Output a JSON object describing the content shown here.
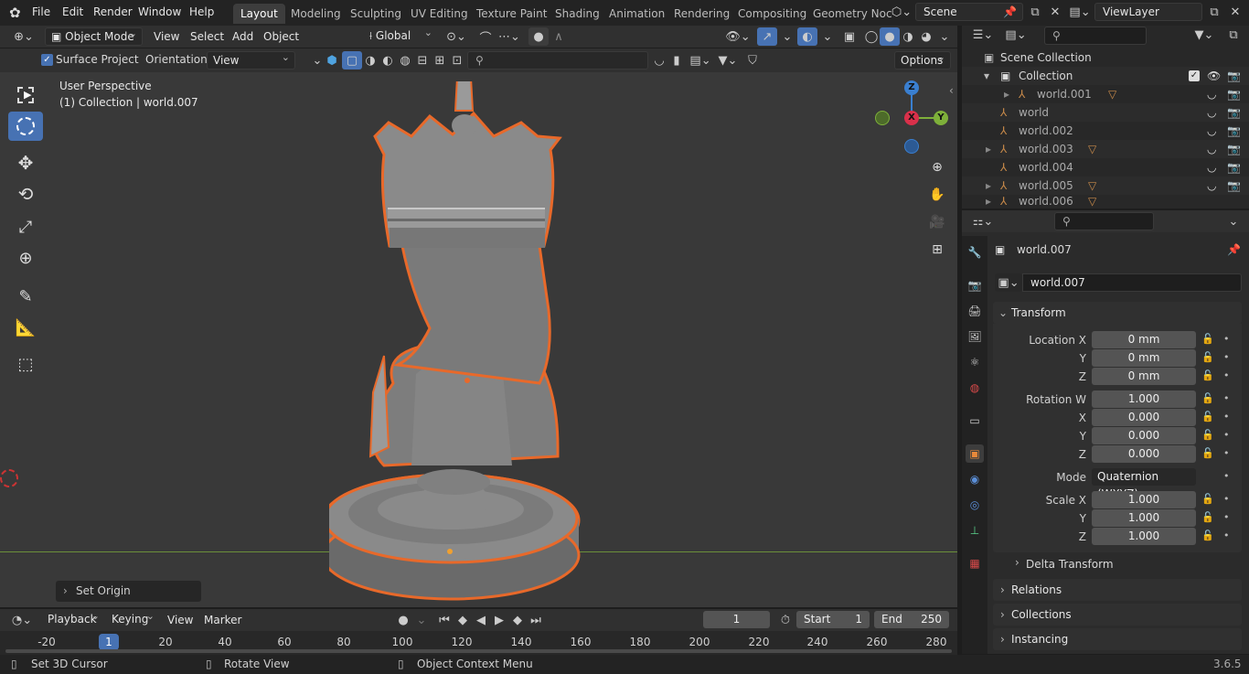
{
  "menus": [
    "File",
    "Edit",
    "Render",
    "Window",
    "Help"
  ],
  "workspaces": [
    "Layout",
    "Modeling",
    "Sculpting",
    "UV Editing",
    "Texture Paint",
    "Shading",
    "Animation",
    "Rendering",
    "Compositing",
    "Geometry Noc"
  ],
  "scene": "Scene",
  "view_layer": "ViewLayer",
  "viewport_header": {
    "mode": "Object Mode",
    "menus": [
      "View",
      "Select",
      "Add",
      "Object"
    ],
    "transform_orientation": "Global"
  },
  "tool_header": {
    "surface_project": "Surface Project",
    "orientation_label": "Orientation:",
    "orientation_value": "View",
    "options": "Options"
  },
  "viewport_info": {
    "perspective": "User Perspective",
    "collection": "(1) Collection | world.007"
  },
  "gizmo": {
    "z": "Z",
    "x": "X",
    "y": "Y"
  },
  "last_operator": "Set Origin",
  "outliner": {
    "root": "Scene Collection",
    "collection": "Collection",
    "items": [
      "world.001",
      "world",
      "world.002",
      "world.003",
      "world.004",
      "world.005",
      "world.006"
    ]
  },
  "properties": {
    "object_name": "world.007",
    "datablock": "world.007",
    "transform_label": "Transform",
    "location_label": "Location X",
    "loc": {
      "x": "0 mm",
      "y": "0 mm",
      "z": "0 mm"
    },
    "rotation_label": "Rotation W",
    "rot": {
      "w": "1.000",
      "x": "0.000",
      "y": "0.000",
      "z": "0.000"
    },
    "mode_label": "Mode",
    "mode_value": "Quaternion (WXYZ)",
    "scale_label": "Scale X",
    "scale": {
      "x": "1.000",
      "y": "1.000",
      "z": "1.000"
    },
    "axis": {
      "y": "Y",
      "z": "Z",
      "x": "X"
    },
    "delta": "Delta Transform",
    "relations": "Relations",
    "collections": "Collections",
    "instancing": "Instancing"
  },
  "timeline": {
    "playback": "Playback",
    "keying": "Keying",
    "view": "View",
    "marker": "Marker",
    "current_frame": "1",
    "start_label": "Start",
    "start": "1",
    "end_label": "End",
    "end": "250",
    "ticks": [
      "-20",
      "1",
      "20",
      "40",
      "60",
      "80",
      "100",
      "120",
      "140",
      "160",
      "180",
      "200",
      "220",
      "240",
      "260",
      "280"
    ]
  },
  "status": {
    "left": "Set 3D Cursor",
    "middle": "Rotate View",
    "right": "Object Context Menu",
    "version": "3.6.5"
  }
}
